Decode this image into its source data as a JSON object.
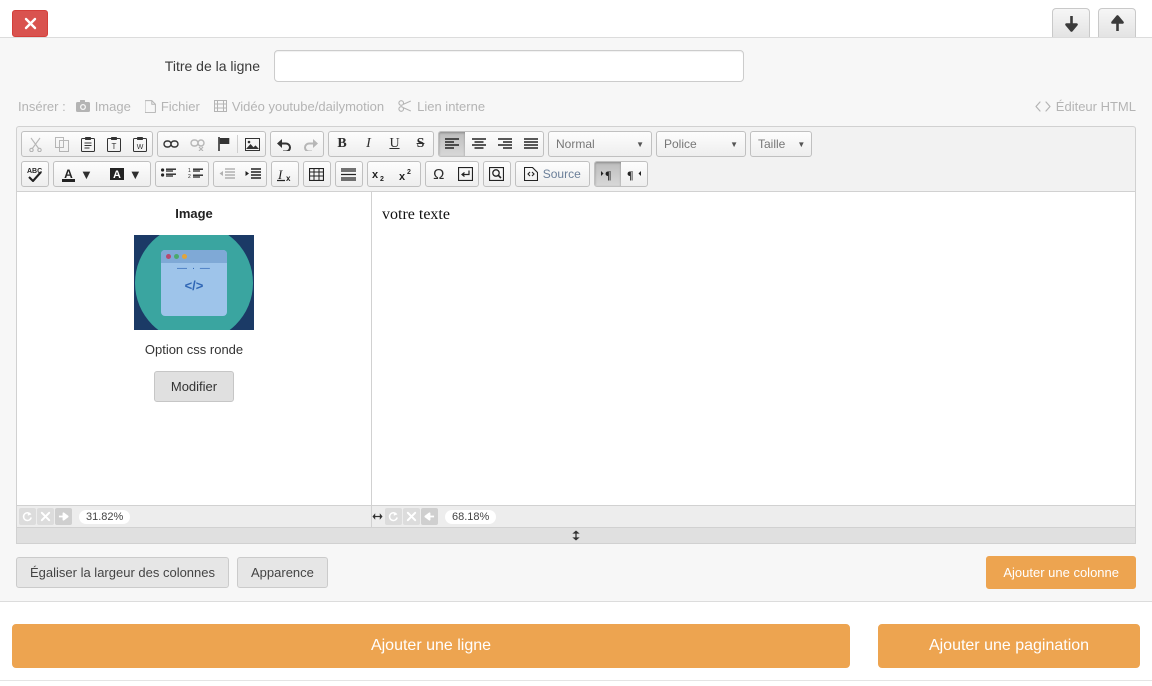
{
  "window": {
    "close_label": "✖",
    "move_down_icon": "arrow-down-icon",
    "move_up_icon": "arrow-up-icon"
  },
  "row_title": {
    "label": "Titre de la ligne",
    "value": "",
    "placeholder": ""
  },
  "insert_bar": {
    "label": "Insérer :",
    "items": [
      {
        "label": "Image",
        "icon": "camera-icon"
      },
      {
        "label": "Fichier",
        "icon": "file-icon"
      },
      {
        "label": "Vidéo youtube/dailymotion",
        "icon": "film-icon"
      },
      {
        "label": "Lien interne",
        "icon": "link-icon"
      }
    ],
    "html_editor": {
      "label": "Éditeur HTML",
      "icon": "code-icon"
    }
  },
  "editor_toolbar": {
    "row1": {
      "clipboard": [
        {
          "name": "cut",
          "glyph": "✂",
          "disabled": true
        },
        {
          "name": "copy",
          "glyph": "⧉",
          "disabled": true
        },
        {
          "name": "paste",
          "glyph": "📋",
          "disabled": false
        },
        {
          "name": "paste-as-text",
          "glyph": "T",
          "disabled": false
        },
        {
          "name": "paste-from-word",
          "glyph": "W",
          "disabled": false
        }
      ],
      "links": [
        {
          "name": "link",
          "glyph": "🔗",
          "disabled": false
        },
        {
          "name": "unlink",
          "glyph": "⛓",
          "disabled": true
        },
        {
          "name": "anchor",
          "glyph": "⚑",
          "disabled": false
        },
        {
          "name": "image",
          "glyph": "🖼",
          "disabled": false
        }
      ],
      "history": [
        {
          "name": "undo",
          "glyph": "↶",
          "disabled": false
        },
        {
          "name": "redo",
          "glyph": "↷",
          "disabled": true
        }
      ],
      "basic_styles": [
        {
          "name": "bold",
          "glyph": "B",
          "disabled": false
        },
        {
          "name": "italic",
          "glyph": "I",
          "disabled": false
        },
        {
          "name": "underline",
          "glyph": "U",
          "disabled": false
        },
        {
          "name": "strike",
          "glyph": "S",
          "disabled": false
        }
      ],
      "align": [
        {
          "name": "align-left",
          "active": true
        },
        {
          "name": "align-center",
          "active": false
        },
        {
          "name": "align-right",
          "active": false
        },
        {
          "name": "align-justify",
          "active": false
        }
      ],
      "dropdowns": {
        "format": "Normal",
        "font": "Police",
        "size": "Taille"
      }
    },
    "row2": {
      "spellcheck": {
        "name": "spellchecker",
        "label": "ABC"
      },
      "colors": [
        {
          "name": "text-color",
          "glyph": "A"
        },
        {
          "name": "background-color",
          "glyph": "A"
        }
      ],
      "lists": [
        {
          "name": "bulleted-list"
        },
        {
          "name": "numbered-list"
        }
      ],
      "indent": [
        {
          "name": "outdent",
          "disabled": true
        },
        {
          "name": "indent",
          "disabled": false
        }
      ],
      "remove_format": {
        "name": "remove-format",
        "glyph": "Ix"
      },
      "table": {
        "name": "table"
      },
      "horizontal_rule": {
        "name": "horizontal-rule"
      },
      "scripts": [
        {
          "name": "subscript",
          "glyph": "x₂"
        },
        {
          "name": "superscript",
          "glyph": "x²"
        }
      ],
      "special": [
        {
          "name": "special-character",
          "glyph": "Ω"
        },
        {
          "name": "page-break",
          "glyph": "⏎"
        }
      ],
      "preview": {
        "name": "preview"
      },
      "source": {
        "name": "source",
        "label": "Source"
      },
      "direction": [
        {
          "name": "text-direction-ltr",
          "active": true
        },
        {
          "name": "text-direction-rtl",
          "active": false
        }
      ]
    }
  },
  "columns": {
    "left": {
      "caption": "Image",
      "image_alt": "code-window-thumbnail",
      "image_name": "Option css ronde",
      "edit_button": "Modifier",
      "width_percent": "31.82%",
      "controls": [
        {
          "name": "reset",
          "glyph": "↺"
        },
        {
          "name": "delete",
          "glyph": "✕"
        },
        {
          "name": "move-right",
          "glyph": "➜"
        }
      ]
    },
    "right": {
      "text": "votre texte",
      "width_percent": "68.18%",
      "controls": [
        {
          "name": "reset",
          "glyph": "↺"
        },
        {
          "name": "delete",
          "glyph": "✕"
        },
        {
          "name": "move-left",
          "glyph": "➜"
        }
      ]
    },
    "column_resize_handle": "⬌",
    "row_resize_handle": "⬍"
  },
  "actions": {
    "equalize": "Égaliser la largeur des colonnes",
    "appearance": "Apparence",
    "add_column": "Ajouter une colonne"
  },
  "footer": {
    "add_row": "Ajouter une ligne",
    "add_pagination": "Ajouter une pagination"
  },
  "colors": {
    "accent_orange": "#eda450",
    "danger_red": "#d9534f",
    "thumb_navy": "#1b3a66",
    "thumb_teal": "#3aa5a0",
    "thumb_window": "#9ec4ea"
  }
}
